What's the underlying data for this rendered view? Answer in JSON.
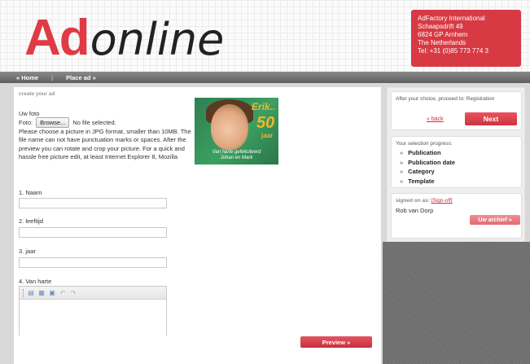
{
  "logo": {
    "part1": "Ad",
    "part2": "online"
  },
  "address": [
    "AdFactory International",
    "Schaapsdrift 49",
    "6824 GP Arnhem",
    "The Netherlands",
    "Tel: +31 (0)85 773 774 3"
  ],
  "nav": {
    "home": "« Home",
    "separator": "|",
    "place_ad": "Place ad »"
  },
  "main": {
    "section_title": "create your ad",
    "foto_title": "Uw foto",
    "foto_label": "Foto:",
    "browse_label": "Browse...",
    "file_status": "No file selected.",
    "foto_help": "Please choose a picture in JPG format, smaller than 10MB. The file name can not have punctuation marks or spaces. After the preview you can rotate and crop your picture. For a quick and hassle free picture edit, at least Internet Explorer 8, Mozilla",
    "preview_image": {
      "name": "Erik..",
      "number": "50",
      "unit": "jaar",
      "caption_line1": "Van harte gefeliciteerd",
      "caption_line2": "Johan en Mark"
    },
    "fields": [
      {
        "label": "1. Naam",
        "value": ""
      },
      {
        "label": "2. leeftijd",
        "value": ""
      },
      {
        "label": "3. jaar",
        "value": ""
      }
    ],
    "editor_label": "4. Van harte",
    "editor_value": "",
    "toolbar_icons": [
      "paste-icon",
      "paste-text-icon",
      "paste-word-icon",
      "undo-icon",
      "redo-icon"
    ],
    "preview_button": "Preview »"
  },
  "sidebar": {
    "choice_note": "After your choice, proceed to: Registration",
    "back_link": "« back",
    "next_button": "Next",
    "progress_title": "Your selection progress:",
    "progress_items": [
      "Publication",
      "Publication date",
      "Category",
      "Template"
    ],
    "bullet": "»",
    "signed_label": "signed on as:",
    "signoff_link": "[Sign-off]",
    "user_name": "Rob van Dorp",
    "archive_button": "Uw archief »"
  },
  "colors": {
    "brand_red": "#e03a46",
    "button_red": "#cd3240",
    "nav_gray": "#6e6e6e"
  }
}
